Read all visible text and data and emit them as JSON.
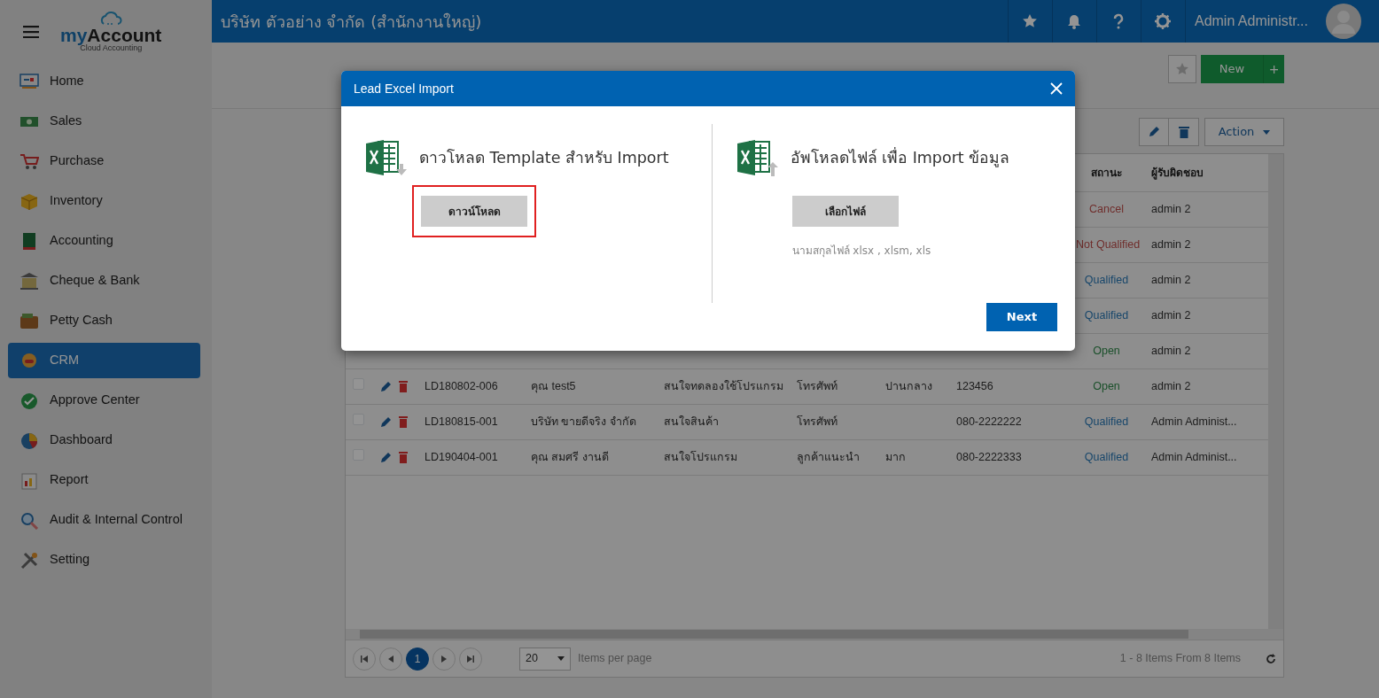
{
  "brand": {
    "name_part1": "my",
    "name_part2": "Account",
    "tagline": "Cloud Accounting"
  },
  "sidebar": {
    "items": [
      {
        "label": "Home",
        "selected": false
      },
      {
        "label": "Sales",
        "selected": false
      },
      {
        "label": "Purchase",
        "selected": false
      },
      {
        "label": "Inventory",
        "selected": false
      },
      {
        "label": "Accounting",
        "selected": false
      },
      {
        "label": "Cheque & Bank",
        "selected": false
      },
      {
        "label": "Petty Cash",
        "selected": false
      },
      {
        "label": "CRM",
        "selected": true
      },
      {
        "label": "Approve Center",
        "selected": false
      },
      {
        "label": "Dashboard",
        "selected": false
      },
      {
        "label": "Report",
        "selected": false
      },
      {
        "label": "Audit & Internal Control",
        "selected": false
      },
      {
        "label": "Setting",
        "selected": false
      }
    ]
  },
  "topbar": {
    "company": "บริษัท ตัวอย่าง จำกัด (สำนักงานใหญ่)",
    "user": "Admin Administr..."
  },
  "page_actions": {
    "new_button": "New",
    "add_button": "+"
  },
  "toolbar": {
    "action_button": "Action"
  },
  "table": {
    "columns": [
      {
        "label": "สถานะ"
      },
      {
        "label": "ผู้รับผิดชอบ"
      }
    ],
    "rows": [
      {
        "status": "Cancel",
        "kind": "closed",
        "owner": "admin 2"
      },
      {
        "status": "Not Qualified",
        "kind": "closed",
        "owner": "admin 2"
      },
      {
        "status": "Qualified",
        "kind": "qualified",
        "owner": "admin 2"
      },
      {
        "status": "Qualified",
        "kind": "qualified",
        "owner": "admin 2"
      },
      {
        "status": "Open",
        "kind": "open",
        "owner": "admin 2"
      },
      {
        "checked": false,
        "id": "LD180802-006",
        "name": "คุณ test5",
        "interest": "สนใจทดลองใช้โปรแกรม",
        "channel": "โทรศัพท์",
        "area": "ปานกลาง",
        "phone": "123456",
        "status": "Open",
        "kind": "open",
        "owner": "admin 2"
      },
      {
        "checked": false,
        "id": "LD180815-001",
        "name": "บริษัท ขายดีจริง จำกัด",
        "interest": "สนใจสินค้า",
        "channel": "โทรศัพท์",
        "phone": "080-2222222",
        "status": "Qualified",
        "kind": "qualified",
        "owner": "Admin Administ..."
      },
      {
        "checked": false,
        "id": "LD190404-001",
        "name": "คุณ สมศรี งานดี",
        "interest": "สนใจโปรแกรม",
        "channel": "ลูกค้าแนะนำ",
        "area": "มาก",
        "phone": "080-2222333",
        "status": "Qualified",
        "kind": "qualified",
        "owner": "Admin Administ..."
      }
    ]
  },
  "pager": {
    "pages": [
      {
        "label": "1",
        "selected": true
      }
    ],
    "page_size": "20",
    "page_size_label": "Items per page",
    "summary": "1 - 8 Items From 8 Items"
  },
  "modal": {
    "title": "Lead Excel Import",
    "download": {
      "heading": "ดาวโหลด Template สำหรับ Import",
      "button": "ดาวน์โหลด",
      "highlighted": true
    },
    "upload": {
      "heading": "อัพโหลดไฟล์ เพื่อ Import ข้อมูล",
      "button": "เลือกไฟล์",
      "hint": "นามสกุลไฟล์ xlsx , xlsm, xls"
    },
    "next_button": "Next"
  }
}
